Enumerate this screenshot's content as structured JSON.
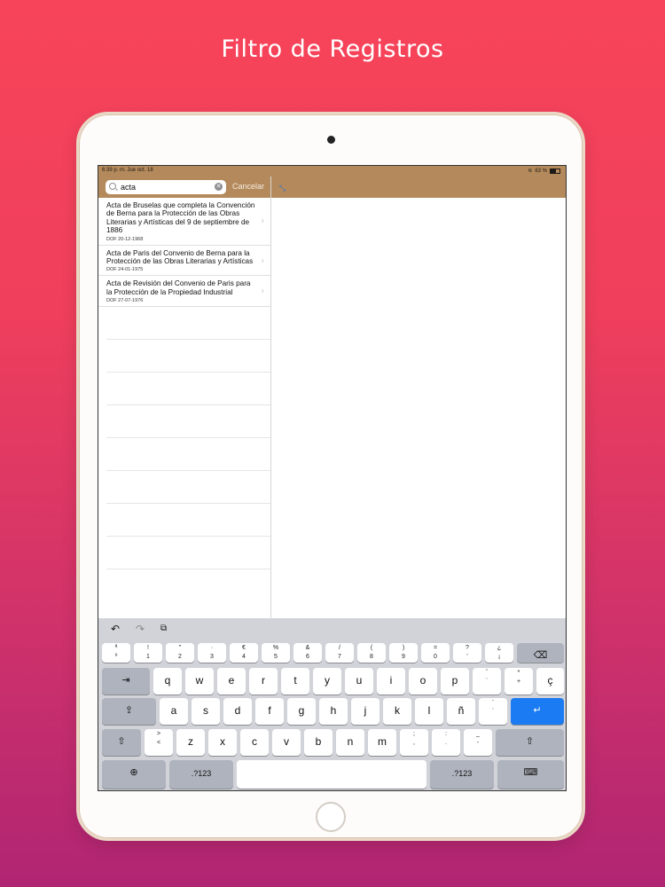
{
  "headline": "Filtro de Registros",
  "status": {
    "time": "6:39 p. m.   Jue oct. 18",
    "battery": "63 %"
  },
  "search": {
    "value": "acta",
    "cancel_label": "Cancelar"
  },
  "results": [
    {
      "title": "Acta de Bruselas que completa la Convención de Berna para la Protección de las Obras Literarias y Artísticas del 9 de septiembre de 1886",
      "date": "DOF 20-12-1968"
    },
    {
      "title": "Acta de Paris del Convenio de Berna para la Protección de las Obras Literarias y Artísticas",
      "date": "DOF 24-01-1975"
    },
    {
      "title": "Acta de Revisión del Convenio de Paris para la Protección de la Propiedad Industrial",
      "date": "DOF 27-07-1976"
    }
  ],
  "keyboard": {
    "row1": [
      [
        "ª",
        "º"
      ],
      [
        "!",
        "1"
      ],
      [
        "\"",
        "2"
      ],
      [
        "·",
        "3"
      ],
      [
        "€",
        "4"
      ],
      [
        "%",
        "5"
      ],
      [
        "&",
        "6"
      ],
      [
        "/",
        "7"
      ],
      [
        "(",
        "8"
      ],
      [
        ")",
        "9"
      ],
      [
        "=",
        "0"
      ],
      [
        "?",
        "'"
      ],
      [
        "¿",
        "¡"
      ]
    ],
    "row2": [
      "q",
      "w",
      "e",
      "r",
      "t",
      "y",
      "u",
      "i",
      "o",
      "p"
    ],
    "row2_extra": [
      [
        "ˆ",
        "`"
      ],
      [
        "*",
        "+"
      ]
    ],
    "row2_last": "ç",
    "row3": [
      "a",
      "s",
      "d",
      "f",
      "g",
      "h",
      "j",
      "k",
      "l",
      "ñ"
    ],
    "row3_extra": [
      "¨",
      "´"
    ],
    "row4_first": [
      ">",
      "<"
    ],
    "row4": [
      "z",
      "x",
      "c",
      "v",
      "b",
      "n",
      "m"
    ],
    "row4_extra": [
      [
        ";",
        ","
      ],
      [
        ":",
        "."
      ],
      [
        "_",
        "-"
      ]
    ],
    "numbers_label": ".?123"
  }
}
